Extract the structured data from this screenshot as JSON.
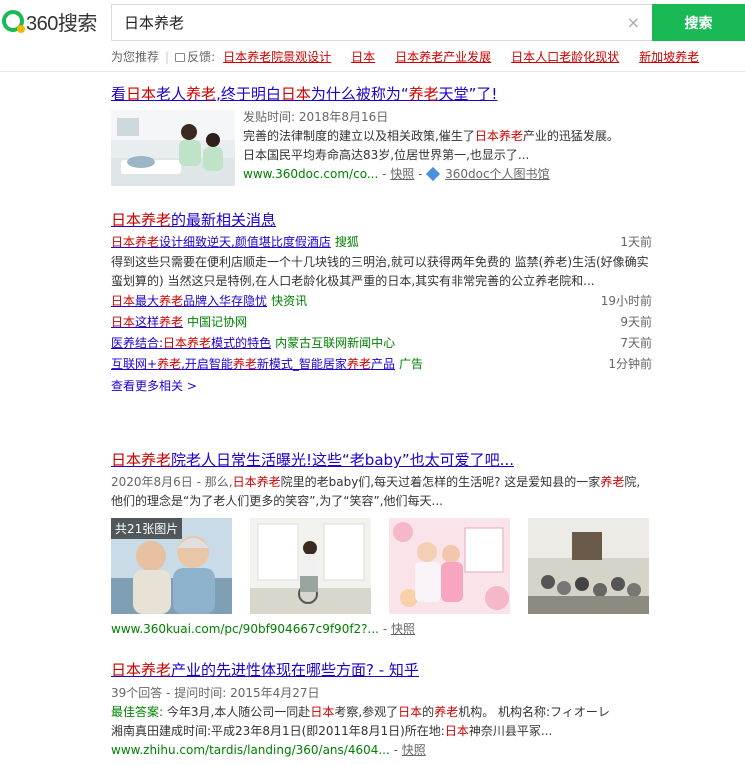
{
  "header": {
    "logo_text": "360搜索",
    "search_value": "日本养老",
    "clear_glyph": "×",
    "search_button": "搜索",
    "accent": "#19b955"
  },
  "suggestions": {
    "label": "为您推荐",
    "feedback": "反馈:",
    "items": [
      "日本养老院景观设计",
      "日本",
      "日本养老产业发展",
      "日本人口老龄化现状",
      "新加坡养老"
    ]
  },
  "result1": {
    "title_parts": [
      "看",
      "日本",
      "老人",
      "养老",
      ",终于明白",
      "日本",
      "为什么被称为“",
      "养老",
      "天堂”了!"
    ],
    "date": "发贴时间: 2018年8月16日",
    "desc_line1_parts": [
      "完善的法律制度的建立以及相关政策,催生了",
      "日本养老",
      "产业的迅猛发展。"
    ],
    "desc_line2": "日本国民平均寿命高达83岁,位居世界第一,也显示了...",
    "url": "www.360doc.com/co...",
    "snapshot": "快照",
    "site": "360doc个人图书馆"
  },
  "result2": {
    "title_parts": [
      "日本养老",
      "的最新相关消息"
    ],
    "news": [
      {
        "title_parts": [
          "日本养老",
          "设计细致逆天,颜值堪比度假酒店"
        ],
        "source": "搜狐",
        "time": "1天前"
      },
      {
        "title_parts": [
          "日本",
          "最大",
          "养老",
          "品牌入华存隐忧"
        ],
        "source": "快资讯",
        "time": "19小时前"
      },
      {
        "title_parts": [
          "日本",
          "这样",
          "养老"
        ],
        "source": "中国记协网",
        "time": "9天前"
      },
      {
        "title_parts": [
          "医养结合:",
          "日本养老",
          "模式的特色"
        ],
        "source": "内蒙古互联网新闻中心",
        "time": "7天前"
      },
      {
        "title_parts": [
          "互联网+",
          "养老",
          ",开启智能",
          "养老",
          "新模式_智能居家",
          "养老",
          "产品"
        ],
        "source": "广告",
        "time": "1分钟前"
      }
    ],
    "desc": "得到这些只需要在便利店顺走一个十几块钱的三明治,就可以获得两年免费的 监禁(养老)生活(好像确实蛮划算的) 当然这只是特例,在人口老龄化极其严重的日本,其实有非常完善的公立养老院和...",
    "more": "查看更多相关 >"
  },
  "result3": {
    "title_parts": [
      "日本养老",
      "院老人日常生活曝光!这些“老baby”也太可爱了吧..."
    ],
    "desc_parts": [
      "2020年8月6日",
      " - 那么,",
      "日本养老",
      "院里的老baby们,每天过着怎样的生活呢? 这是爱知县的一家",
      "养老",
      "院,他们的理念是“为了老人们更多的笑容”,为了“笑容”,他们每天..."
    ],
    "image_count": "共21张图片",
    "url": "www.360kuai.com/pc/90bf904667c9f90f2?...",
    "snapshot": "快照"
  },
  "result4": {
    "title_parts": [
      "日本养老",
      "产业的先进性体现在哪些方面? - 知乎"
    ],
    "meta": "39个回答 - 提问时间: 2015年4月27日",
    "best_label": "最佳答案:",
    "answer_line1_parts": [
      " 今年3月,本人随公司一同赴",
      "日本",
      "考察,参观了",
      "日本",
      "的",
      "养老",
      "机构。 机构名称:フィオーレ"
    ],
    "answer_line2_parts": [
      "湘南真田建成时间:平成23年8月1日(即2011年8月1日)所在地:",
      "日本",
      "神奈川县平冢..."
    ],
    "url": "www.zhihu.com/tardis/landing/360/ans/4604...",
    "snapshot": "快照"
  }
}
